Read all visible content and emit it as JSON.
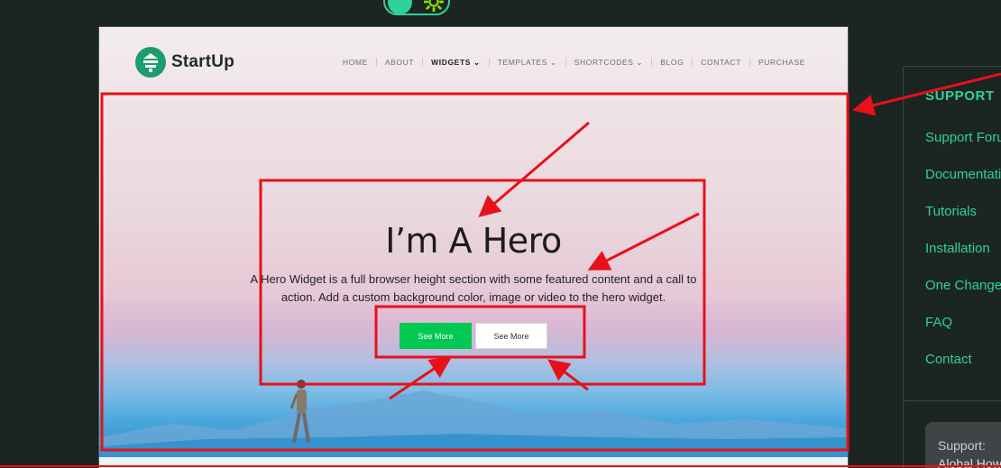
{
  "site": {
    "logo_text": "StartUp",
    "nav": [
      "HOME",
      "ABOUT",
      "WIDGETS",
      "TEMPLATES",
      "SHORTCODES",
      "BLOG",
      "CONTACT",
      "PURCHASE"
    ],
    "active_nav": "WIDGETS"
  },
  "hero": {
    "title": "I’m A Hero",
    "description": "A Hero Widget is a full browser height section with some featured content and a call to action. Add a custom background color, image or video to the hero widget.",
    "primary_button": "See More",
    "secondary_button": "See More"
  },
  "support": {
    "title": "SUPPORT",
    "links": [
      "Support Forum",
      "Documentation",
      "Tutorials",
      "Installation",
      "One Change",
      "FAQ",
      "Contact"
    ],
    "card_label": "Support:",
    "card_sub": "Alobal How"
  },
  "colors": {
    "accent": "#2fd39a",
    "annotation": "#e8101a",
    "primary_button": "#00c853",
    "background": "#1b2521"
  }
}
